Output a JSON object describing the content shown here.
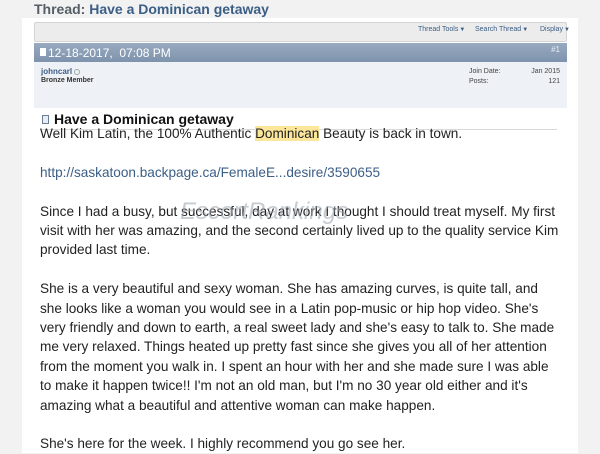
{
  "thread": {
    "prefix": "Thread:",
    "title": "Have a Dominican getaway"
  },
  "toolbar": {
    "thread_tools": "Thread Tools",
    "search_thread": "Search Thread",
    "display": "Display"
  },
  "post": {
    "date": "12-18-2017,  07:08 PM",
    "number": "#1",
    "user": {
      "name": "johncarl",
      "rank": "Bronze Member",
      "join_label": "Join Date:",
      "join_value": "Jan 2015",
      "posts_label": "Posts:",
      "posts_value": "121"
    },
    "title": "Have a Dominican getaway",
    "p1_before": "Well Kim Latin, the 100% Authentic ",
    "p1_highlight": "Dominican",
    "p1_after": " Beauty is back in town.",
    "link": "http://saskatoon.backpage.ca/FemaleE...desire/3590655",
    "p2": "Since I had a busy, but successful, day at work I thought I should treat myself. My first visit with her was amazing, and the second certainly lived up to the quality service Kim provided last time.",
    "p3": "She is a very beautiful and sexy woman. She has amazing curves, is quite tall, and she looks like a woman you would see in a Latin pop-music or hip hop video. She's very friendly and down to earth, a real sweet lady and she's easy to talk to. She made me very relaxed. Things heated up pretty fast since she gives you all of her attention from the moment you walk in. I spent an hour with her and she made sure I was able to make it happen twice!! I'm not an old man, but I'm no 30 year old either and it's amazing what a beautiful and attentive woman can make happen.",
    "p4": "She's here for the week. I highly recommend you go see her."
  },
  "watermark": "EscortRankings"
}
